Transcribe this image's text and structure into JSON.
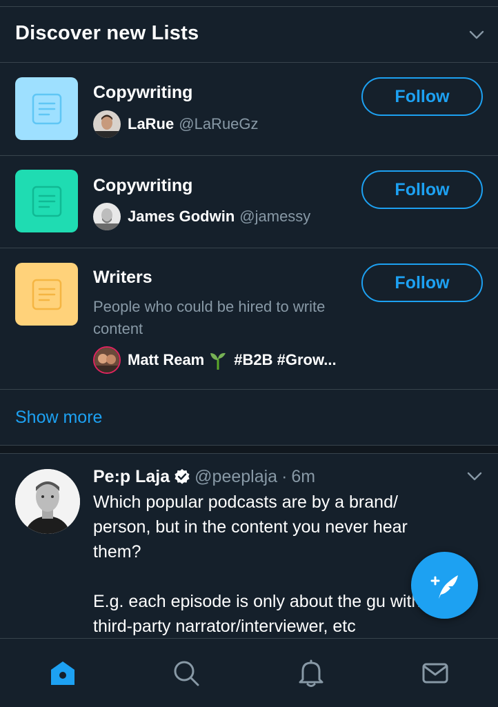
{
  "colors": {
    "background": "#15202b",
    "divider": "#38444d",
    "accent": "#1da1f2",
    "secondary_text": "#8899a6"
  },
  "discover": {
    "title": "Discover new Lists",
    "collapse_icon": "chevron-down-icon",
    "lists": [
      {
        "name": "Copywriting",
        "icon_color": "#9ee0ff",
        "icon": "list-icon",
        "owner_name": "LaRue",
        "owner_handle": "@LaRueGz",
        "follow_label": "Follow"
      },
      {
        "name": "Copywriting",
        "icon_color": "#1fdcb2",
        "icon": "list-icon",
        "owner_name": "James Godwin",
        "owner_handle": "@jamessy",
        "follow_label": "Follow"
      },
      {
        "name": "Writers",
        "icon_color": "#ffd27a",
        "icon": "list-icon",
        "description": "People who could be hired to write content",
        "owner_name": "Matt Ream",
        "owner_name_emoji": "seedling-icon",
        "owner_suffix": "#B2B #Grow...",
        "follow_label": "Follow"
      }
    ],
    "show_more": "Show more"
  },
  "tweet": {
    "author_name": "Pe:p Laja",
    "verified_icon": "verified-badge-icon",
    "author_handle": "@peeplaja",
    "separator": "·",
    "time": "6m",
    "text": "Which popular podcasts are by a brand/ person, but in the content you never hear them?\n\nE.g. each episode is only about the gu with a third-party narrator/interviewer, etc"
  },
  "compose_button": "compose-tweet-icon",
  "bottom_nav": [
    "home-icon",
    "search-icon",
    "notifications-bell-icon",
    "messages-envelope-icon"
  ]
}
